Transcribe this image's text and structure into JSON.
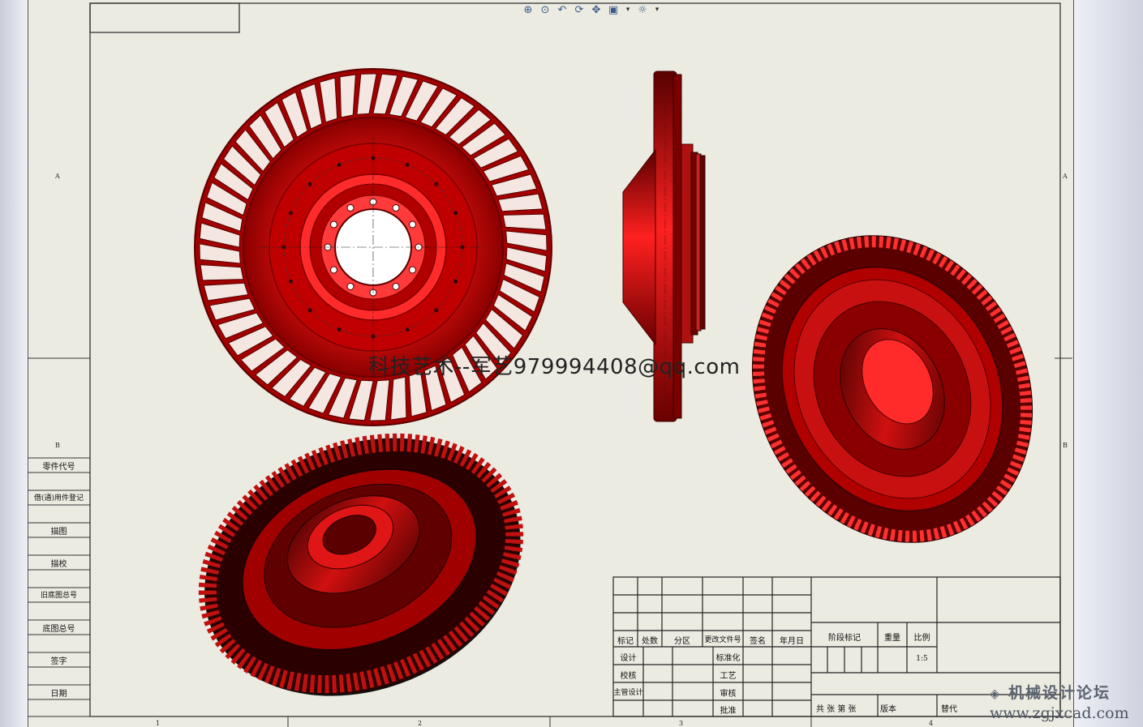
{
  "toolbar": {
    "buttons": [
      {
        "name": "zoom-to-fit-icon",
        "glyph": "⊕"
      },
      {
        "name": "zoom-to-area-icon",
        "glyph": "⊙"
      },
      {
        "name": "previous-view-icon",
        "glyph": "↶"
      },
      {
        "name": "rotate-view-icon",
        "glyph": "⟳"
      },
      {
        "name": "pan-view-icon",
        "glyph": "✥"
      },
      {
        "name": "display-style-icon",
        "glyph": "▣"
      },
      {
        "name": "display-style-dropdown-icon",
        "glyph": "▾"
      },
      {
        "name": "hide-show-items-icon",
        "glyph": "☼"
      },
      {
        "name": "hide-show-dropdown-icon",
        "glyph": "▾"
      }
    ]
  },
  "watermark": "科技艺术--军艺979994408@qq.com",
  "zones": {
    "left_a": "A",
    "left_b": "B",
    "right_a": "A",
    "right_b": "B",
    "bottom": [
      "1",
      "2",
      "3",
      "4"
    ]
  },
  "side_labels": [
    "零件代号",
    "借(通)用件登记",
    "描图",
    "描校",
    "旧底图总号",
    "底图总号",
    "签字",
    "日期"
  ],
  "title_block": {
    "rev_headers": [
      "标记",
      "处数",
      "分区",
      "更改文件号",
      "签名",
      "年月日"
    ],
    "designer": "设计",
    "checker": "校核",
    "chief_designer": "主管设计",
    "standardization": "标准化",
    "process": "工艺",
    "review": "审核",
    "approve": "批准",
    "stage_mark": "阶段标记",
    "weight": "重量",
    "scale_label": "比例",
    "scale_value": "1:5",
    "sheets": "共  张  第  张",
    "version": "版本",
    "replace": "替代"
  },
  "logo": {
    "line1": "机械设计论坛",
    "line2": "www.zgjxcad.com"
  },
  "colors": {
    "part": "#d40000",
    "part_dark": "#5a0000",
    "sheet": "#ecebe1",
    "line": "#333333"
  }
}
